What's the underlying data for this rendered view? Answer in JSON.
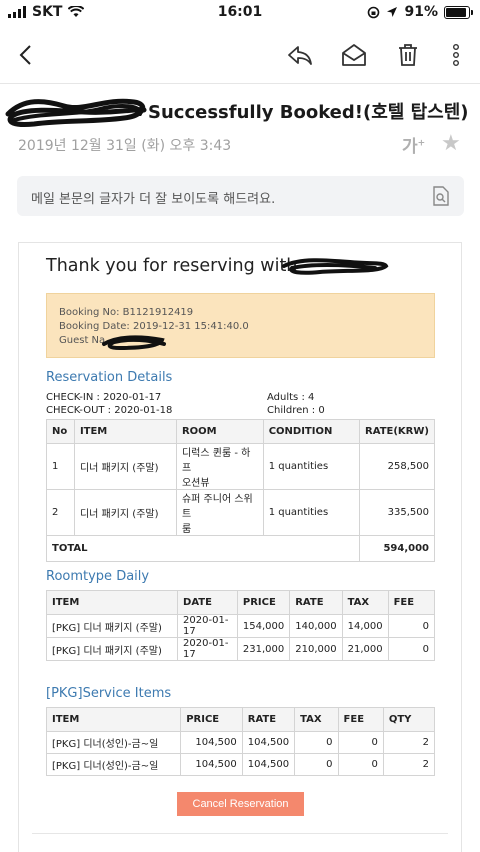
{
  "status_bar": {
    "carrier": "SKT",
    "time": "16:01",
    "battery": "91%",
    "battery_level": 0.91
  },
  "toolbar": {
    "back_icon": "chevron-left-icon",
    "reply_icon": "reply-icon",
    "read_icon": "envelope-open-icon",
    "delete_icon": "trash-icon",
    "more_icon": "more-vertical-icon"
  },
  "mail": {
    "subject_tail": "Successfully Booked!(호텔 탑스텐)",
    "date": "2019년 12월 31일 (화) 오후 3:43",
    "font_size_label": "가",
    "read_helper": "메일 본문의 글자가 더 잘 보이도록 해드려요."
  },
  "body": {
    "thanks": "Thank you for reserving with",
    "booking_no": "Booking No: B1121912419",
    "booking_date": "Booking Date: 2019-12-31 15:41:40.0",
    "guest_name": "Guest Na",
    "reservation_title": "Reservation Details",
    "check_in": "CHECK-IN : 2020-01-17",
    "check_out": "CHECK-OUT : 2020-01-18",
    "adults": "Adults : 4",
    "children": "Children : 0",
    "res_headers": [
      "No",
      "ITEM",
      "ROOM",
      "CONDITION",
      "RATE(KRW)"
    ],
    "res_rows": [
      {
        "no": "1",
        "item": "디너 패키지 (주말)",
        "room_l1": "디럭스 퀸룸 - 하프",
        "room_l2": "오션뷰",
        "condition": "1 quantities",
        "rate": "258,500"
      },
      {
        "no": "2",
        "item": "디너 패키지 (주말)",
        "room_l1": "슈퍼 주니어 스위트",
        "room_l2": "룸",
        "condition": "1 quantities",
        "rate": "335,500"
      }
    ],
    "total_label": "TOTAL",
    "total_value": "594,000",
    "roomtype_title": "Roomtype Daily",
    "rt_headers": [
      "ITEM",
      "DATE",
      "PRICE",
      "RATE",
      "TAX",
      "FEE"
    ],
    "rt_rows": [
      {
        "item": "[PKG] 디너 패키지 (주말)",
        "date": "2020-01-17",
        "price": "154,000",
        "rate": "140,000",
        "tax": "14,000",
        "fee": "0"
      },
      {
        "item": "[PKG] 디너 패키지 (주말)",
        "date": "2020-01-17",
        "price": "231,000",
        "rate": "210,000",
        "tax": "21,000",
        "fee": "0"
      }
    ],
    "service_title": "[PKG]Service Items",
    "sv_headers": [
      "ITEM",
      "PRICE",
      "RATE",
      "TAX",
      "FEE",
      "QTY"
    ],
    "sv_rows": [
      {
        "item": "[PKG] 디너(성인)-금~일",
        "price": "104,500",
        "rate": "104,500",
        "tax": "0",
        "fee": "0",
        "qty": "2"
      },
      {
        "item": "[PKG] 디너(성인)-금~일",
        "price": "104,500",
        "rate": "104,500",
        "tax": "0",
        "fee": "0",
        "qty": "2"
      }
    ],
    "cancel_label": "Cancel Reservation"
  },
  "colors": {
    "accent_blue": "#3d7ab0",
    "info_bg": "#fbe4bd",
    "cancel_bg": "#f4886d"
  }
}
